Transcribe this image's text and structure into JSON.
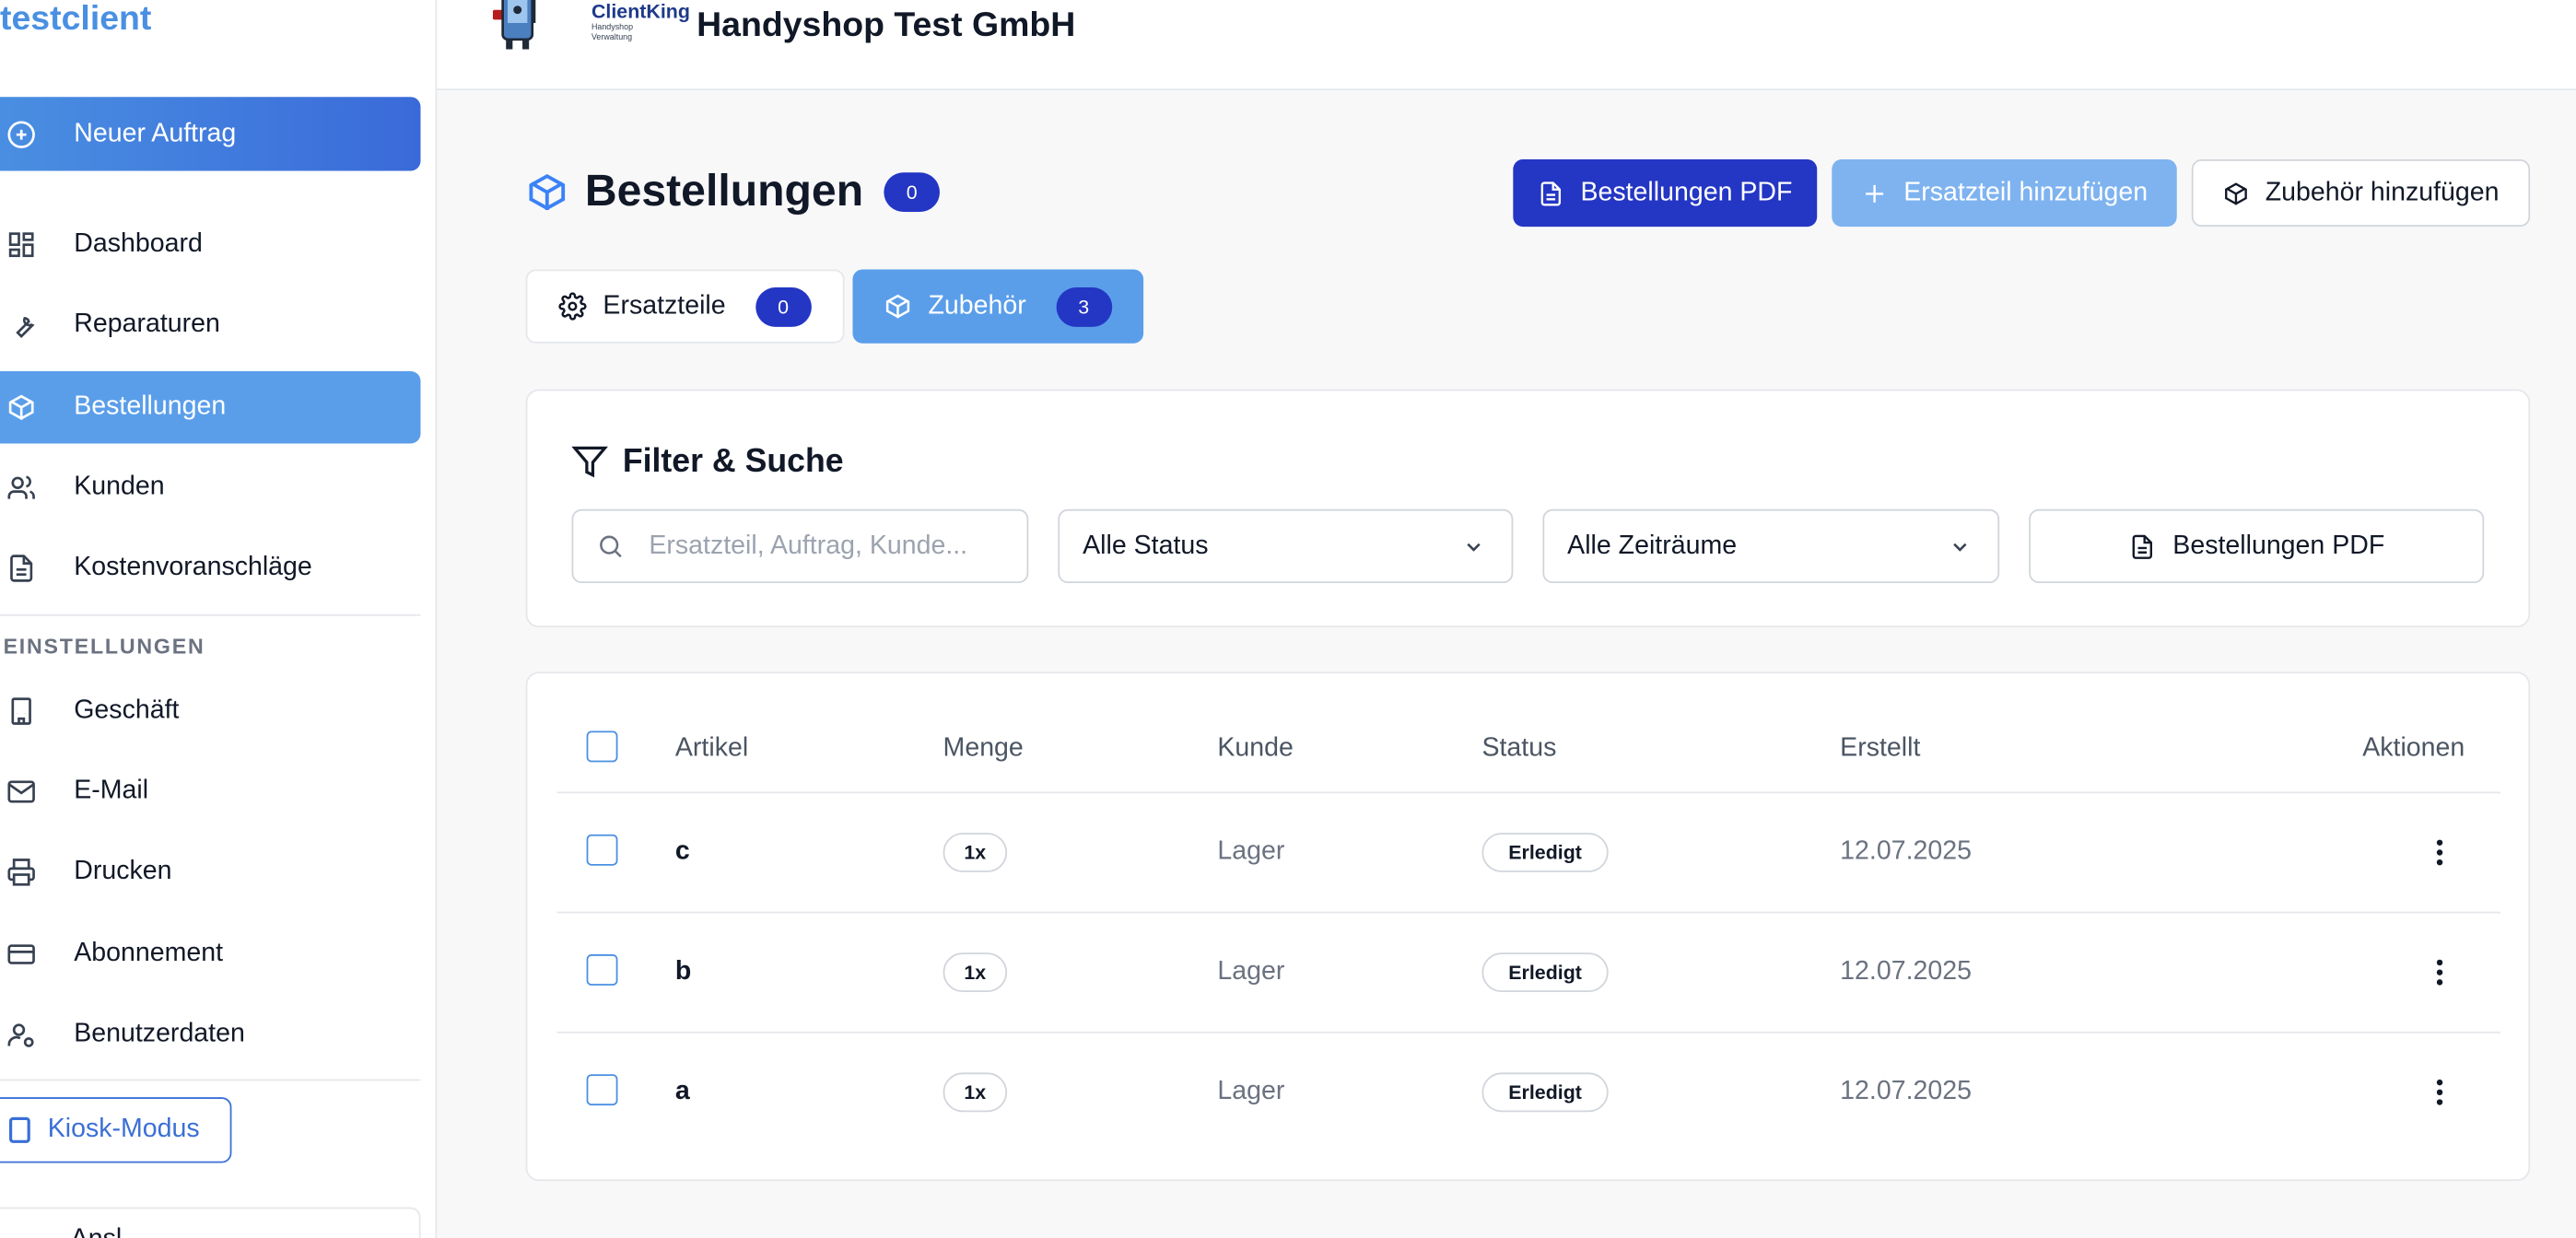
{
  "sidebar": {
    "brand": "testclient",
    "new_order": "Neuer Auftrag",
    "items": [
      {
        "label": "Dashboard",
        "icon": "dashboard-icon"
      },
      {
        "label": "Reparaturen",
        "icon": "wrench-icon"
      },
      {
        "label": "Bestellungen",
        "icon": "package-icon",
        "active": true
      },
      {
        "label": "Kunden",
        "icon": "users-icon"
      },
      {
        "label": "Kostenvoranschläge",
        "icon": "document-icon"
      }
    ],
    "settings_label": "EINSTELLUNGEN",
    "settings_items": [
      {
        "label": "Geschäft",
        "icon": "building-icon"
      },
      {
        "label": "E-Mail",
        "icon": "mail-icon"
      },
      {
        "label": "Drucken",
        "icon": "printer-icon"
      },
      {
        "label": "Abonnement",
        "icon": "credit-card-icon"
      },
      {
        "label": "Benutzerdaten",
        "icon": "user-settings-icon"
      }
    ],
    "kiosk": "Kiosk-Modus",
    "bottom_partial": "Ansl..."
  },
  "header": {
    "logo_title": "ClientKing",
    "logo_subtitle": "Handyshop Verwaltung",
    "company": "Handyshop Test GmbH"
  },
  "page": {
    "title": "Bestellungen",
    "count": "0",
    "actions": {
      "pdf": "Bestellungen PDF",
      "add_part": "Ersatzteil hinzufügen",
      "add_accessory": "Zubehör hinzufügen"
    },
    "tabs": [
      {
        "label": "Ersatzteile",
        "count": "0"
      },
      {
        "label": "Zubehör",
        "count": "3",
        "active": true
      }
    ]
  },
  "filter": {
    "title": "Filter & Suche",
    "search_placeholder": "Ersatzteil, Auftrag, Kunde...",
    "status_value": "Alle Status",
    "period_value": "Alle Zeiträume",
    "pdf_button": "Bestellungen PDF"
  },
  "table": {
    "columns": [
      "Artikel",
      "Menge",
      "Kunde",
      "Status",
      "Erstellt",
      "Aktionen"
    ],
    "rows": [
      {
        "artikel": "c",
        "menge": "1x",
        "kunde": "Lager",
        "status": "Erledigt",
        "erstellt": "12.07.2025"
      },
      {
        "artikel": "b",
        "menge": "1x",
        "kunde": "Lager",
        "status": "Erledigt",
        "erstellt": "12.07.2025"
      },
      {
        "artikel": "a",
        "menge": "1x",
        "kunde": "Lager",
        "status": "Erledigt",
        "erstellt": "12.07.2025"
      }
    ]
  },
  "colors": {
    "primary_dark": "#2436c4",
    "primary_light": "#5a9eea",
    "accent_blue": "#4a90e2"
  }
}
